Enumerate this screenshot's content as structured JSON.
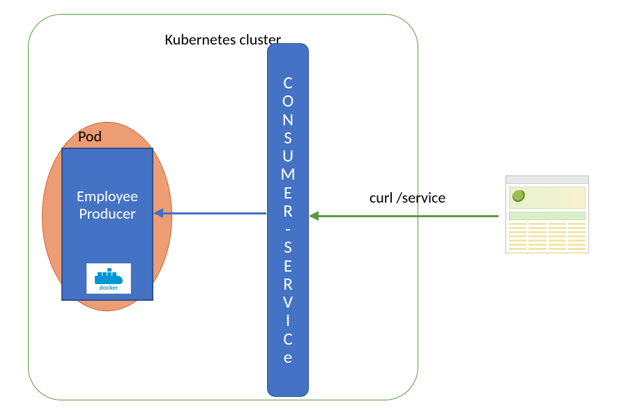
{
  "cluster": {
    "title": "Kubernetes cluster"
  },
  "pod": {
    "label": "Pod",
    "container_name_line1": "Employee",
    "container_name_line2": "Producer",
    "runtime_label": "docker"
  },
  "service": {
    "vertical_text": "C\nO\nN\nS\nU\nM\nE\nR\n-\nS\nE\nR\nV\nI\nC\ne"
  },
  "request": {
    "label": "curl /service"
  },
  "colors": {
    "box_blue": "#4472c4",
    "box_blue_border": "#2f528f",
    "cluster_green": "#5b9b3e",
    "pod_peach": "#ed9d73"
  }
}
